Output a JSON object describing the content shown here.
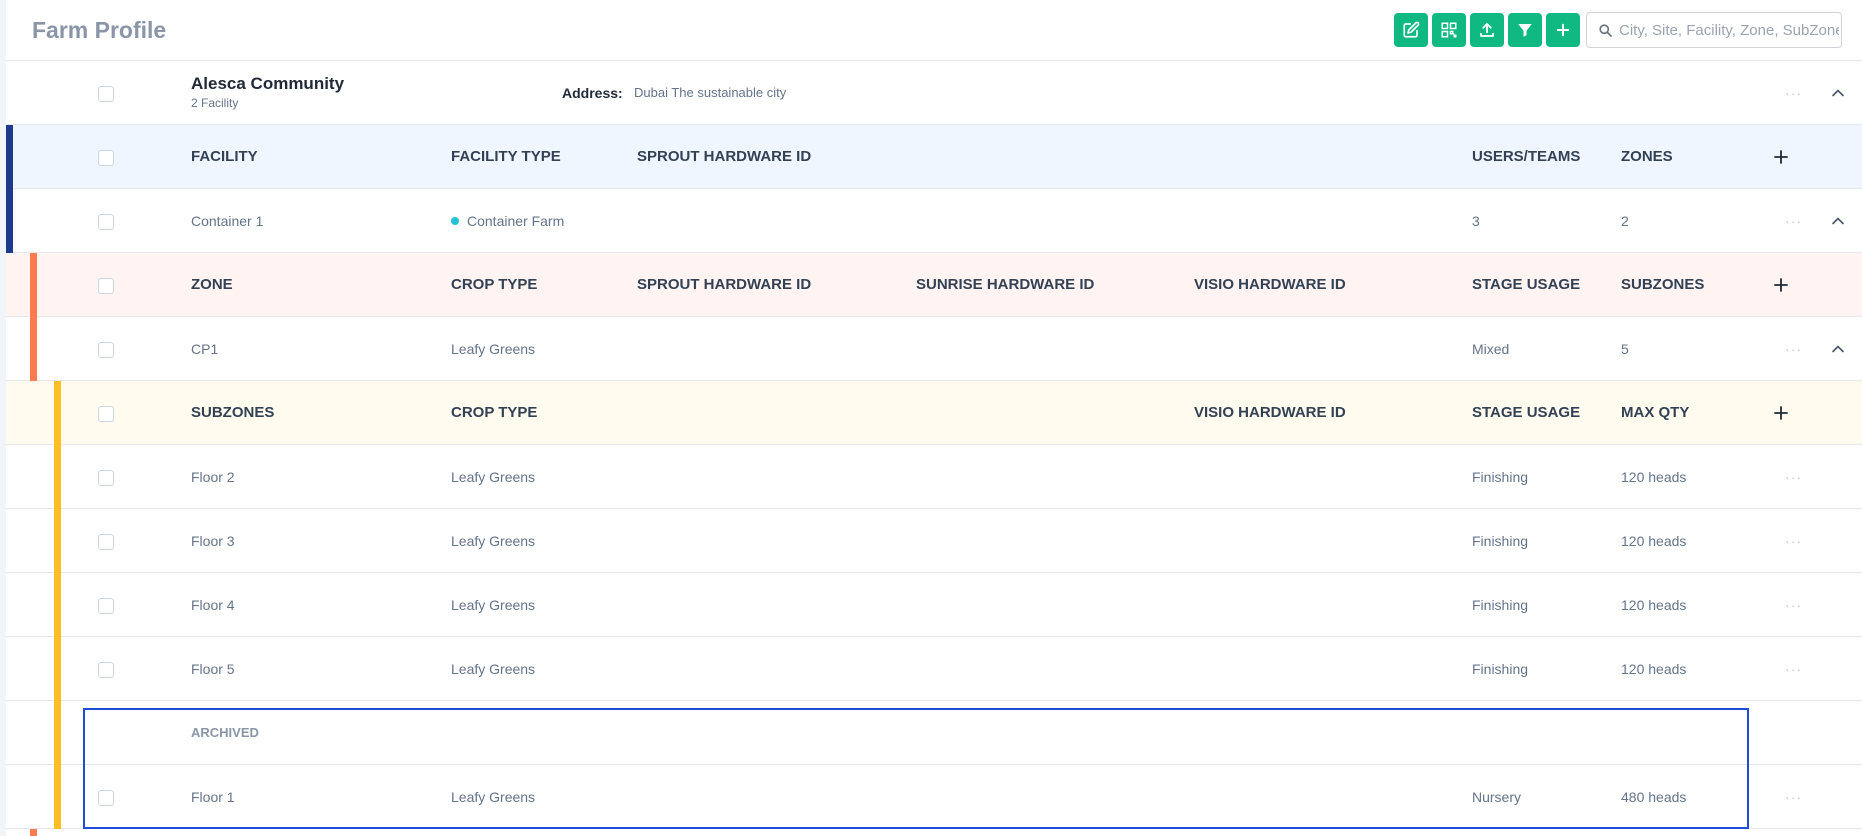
{
  "header": {
    "title": "Farm Profile",
    "search_placeholder": "City, Site, Facility, Zone, SubZone",
    "toolbar_buttons": [
      "edit-icon",
      "qr-code-icon",
      "upload-icon",
      "filter-icon",
      "plus-icon"
    ]
  },
  "colors": {
    "accent": "#10b981",
    "facility_bar": "#1e3a8a",
    "zone_bar": "#f97b4f",
    "subzone_bar": "#fbbf24",
    "highlight_box": "#1d4ed8",
    "facility_type_dot": "#22c3d6"
  },
  "site": {
    "name": "Alesca Community",
    "facility_count": "2 Facility",
    "address_label": "Address:",
    "address_value": "Dubai The sustainable city"
  },
  "facility_table": {
    "headers": {
      "facility": "FACILITY",
      "facility_type": "FACILITY TYPE",
      "sprout_hw": "SPROUT HARDWARE ID",
      "users_teams": "USERS/TEAMS",
      "zones": "ZONES"
    },
    "rows": [
      {
        "name": "Container 1",
        "type": "Container Farm",
        "users_teams": "3",
        "zones": "2"
      }
    ]
  },
  "zone_table": {
    "headers": {
      "zone": "ZONE",
      "crop_type": "CROP TYPE",
      "sprout_hw": "SPROUT HARDWARE ID",
      "sunrise_hw": "SUNRISE HARDWARE ID",
      "visio_hw": "VISIO HARDWARE ID",
      "stage_usage": "STAGE USAGE",
      "subzones": "SUBZONES"
    },
    "rows": [
      {
        "name": "CP1",
        "crop_type": "Leafy Greens",
        "stage_usage": "Mixed",
        "subzones": "5"
      }
    ]
  },
  "subzone_table": {
    "headers": {
      "subzones": "SUBZONES",
      "crop_type": "CROP TYPE",
      "visio_hw": "VISIO HARDWARE ID",
      "stage_usage": "STAGE USAGE",
      "max_qty": "MAX QTY"
    },
    "rows": [
      {
        "name": "Floor 2",
        "crop_type": "Leafy Greens",
        "stage_usage": "Finishing",
        "max_qty": "120 heads"
      },
      {
        "name": "Floor 3",
        "crop_type": "Leafy Greens",
        "stage_usage": "Finishing",
        "max_qty": "120 heads"
      },
      {
        "name": "Floor 4",
        "crop_type": "Leafy Greens",
        "stage_usage": "Finishing",
        "max_qty": "120 heads"
      },
      {
        "name": "Floor 5",
        "crop_type": "Leafy Greens",
        "stage_usage": "Finishing",
        "max_qty": "120 heads"
      }
    ],
    "archived_label": "ARCHIVED",
    "archived_rows": [
      {
        "name": "Floor 1",
        "crop_type": "Leafy Greens",
        "stage_usage": "Nursery",
        "max_qty": "480 heads"
      }
    ]
  },
  "row_menu_label": "···"
}
